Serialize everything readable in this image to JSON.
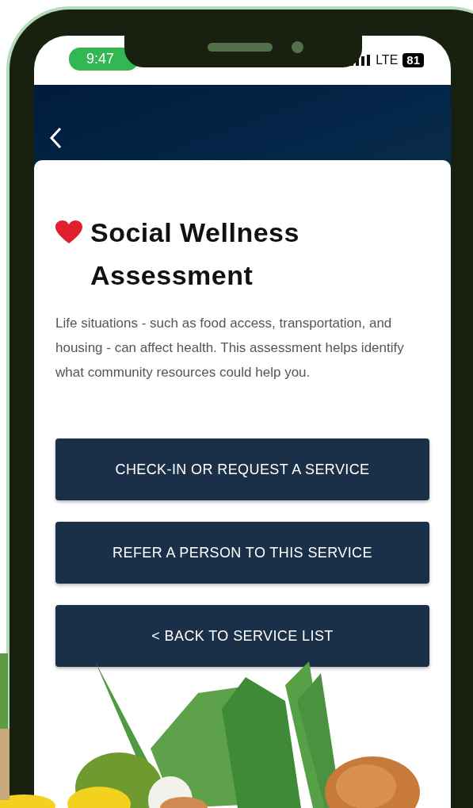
{
  "status_bar": {
    "time": "9:47",
    "network": "LTE",
    "battery": "81"
  },
  "title": "Social Wellness Assessment",
  "description": "Life situations - such as food access, transportation, and housing - can affect health. This assessment helps identify what community resources could help you.",
  "buttons": [
    "CHECK-IN OR REQUEST A SERVICE",
    "REFER A PERSON TO THIS SERVICE",
    "< BACK TO SERVICE LIST"
  ]
}
